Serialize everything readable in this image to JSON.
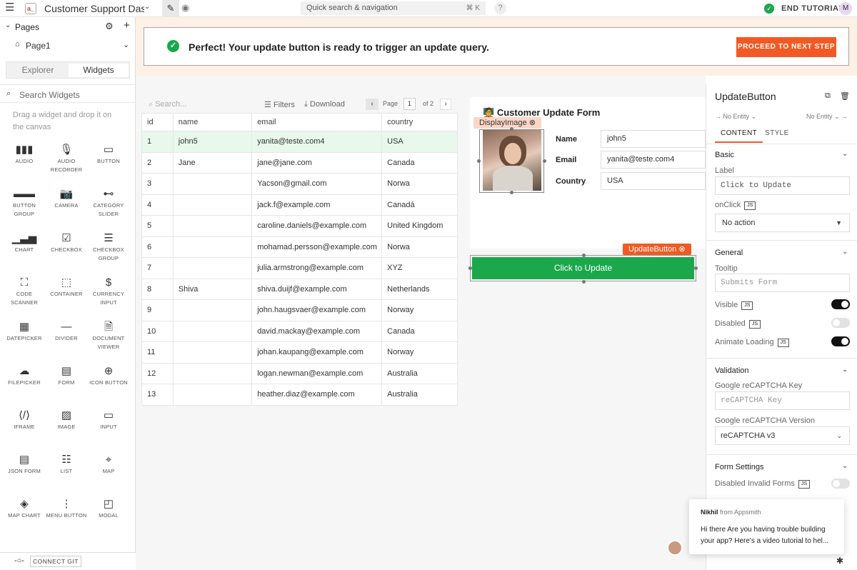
{
  "topbar": {
    "app_title": "Customer Support Das...",
    "search_placeholder": "Quick search & navigation",
    "search_shortcut": "⌘ K",
    "help": "?",
    "end_tutorial": "END TUTORIAL",
    "avatar_initial": "M"
  },
  "sidebar": {
    "pages_title": "Pages",
    "page1": "Page1",
    "tab_explorer": "Explorer",
    "tab_widgets": "Widgets",
    "search_widgets": "Search Widgets",
    "hint": "Drag a widget and drop it on the canvas",
    "widgets": [
      {
        "icon": "audio-icon",
        "glyph": "▮▮▮",
        "name": "AUDIO"
      },
      {
        "icon": "microphone-icon",
        "glyph": "🎙",
        "name": "AUDIO RECORDER"
      },
      {
        "icon": "button-icon",
        "glyph": "▭",
        "name": "BUTTON"
      },
      {
        "icon": "button-group-icon",
        "glyph": "▬▬",
        "name": "BUTTON GROUP"
      },
      {
        "icon": "camera-icon",
        "glyph": "📷",
        "name": "CAMERA"
      },
      {
        "icon": "slider-icon",
        "glyph": "⊷",
        "name": "CATEGORY SLIDER"
      },
      {
        "icon": "chart-icon",
        "glyph": "▁▃▅",
        "name": "CHART"
      },
      {
        "icon": "checkbox-icon",
        "glyph": "☑",
        "name": "CHECKBOX"
      },
      {
        "icon": "checkbox-group-icon",
        "glyph": "☰",
        "name": "CHECKBOX GROUP"
      },
      {
        "icon": "code-scanner-icon",
        "glyph": "⛶",
        "name": "CODE SCANNER"
      },
      {
        "icon": "container-icon",
        "glyph": "⬚",
        "name": "CONTAINER"
      },
      {
        "icon": "currency-input-icon",
        "glyph": "$",
        "name": "CURRENCY INPUT"
      },
      {
        "icon": "datepicker-icon",
        "glyph": "▦",
        "name": "DATEPICKER"
      },
      {
        "icon": "divider-icon",
        "glyph": "—",
        "name": "DIVIDER"
      },
      {
        "icon": "document-viewer-icon",
        "glyph": "🗎",
        "name": "DOCUMENT VIEWER"
      },
      {
        "icon": "filepicker-icon",
        "glyph": "☁",
        "name": "FILEPICKER"
      },
      {
        "icon": "form-icon",
        "glyph": "▤",
        "name": "FORM"
      },
      {
        "icon": "icon-button-icon",
        "glyph": "⊕",
        "name": "ICON BUTTON"
      },
      {
        "icon": "iframe-icon",
        "glyph": "⟨/⟩",
        "name": "IFRAME"
      },
      {
        "icon": "image-icon",
        "glyph": "▨",
        "name": "IMAGE"
      },
      {
        "icon": "input-icon",
        "glyph": "▭",
        "name": "INPUT"
      },
      {
        "icon": "json-form-icon",
        "glyph": "▤",
        "name": "JSON FORM"
      },
      {
        "icon": "list-icon",
        "glyph": "☷",
        "name": "LIST"
      },
      {
        "icon": "map-icon",
        "glyph": "⌖",
        "name": "MAP"
      },
      {
        "icon": "map-chart-icon",
        "glyph": "◈",
        "name": "MAP CHART"
      },
      {
        "icon": "menu-button-icon",
        "glyph": "⋮",
        "name": "MENU BUTTON"
      },
      {
        "icon": "modal-icon",
        "glyph": "◰",
        "name": "MODAL"
      }
    ],
    "connect_git": "CONNECT GIT"
  },
  "banner": {
    "message": "Perfect! Your update button is ready to trigger an update query.",
    "next_button": "PROCEED TO NEXT STEP"
  },
  "table": {
    "search_placeholder": "Search...",
    "filters": "Filters",
    "download": "Download",
    "page_label": "Page",
    "page_number": "1",
    "page_of": "of 2",
    "columns": [
      "id",
      "name",
      "email",
      "country"
    ],
    "rows": [
      [
        "1",
        "john5",
        "yanita@teste.com4",
        "USA"
      ],
      [
        "2",
        "Jane",
        "jane@jane.com",
        "Canada"
      ],
      [
        "3",
        "",
        "Yacson@gmail.com",
        "Norwa"
      ],
      [
        "4",
        "",
        "jack.f@example.com",
        "Canadá"
      ],
      [
        "5",
        "",
        "caroline.daniels@example.com",
        "United Kingdom"
      ],
      [
        "6",
        "",
        "mohamad.persson@example.com",
        "Norwa"
      ],
      [
        "7",
        "",
        "julia.armstrong@example.com",
        "XYZ"
      ],
      [
        "8",
        "Shiva",
        "shiva.duijf@example.com",
        "Netherlands"
      ],
      [
        "9",
        "",
        "john.haugsvaer@example.com",
        "Norway"
      ],
      [
        "10",
        "",
        "david.mackay@example.com",
        "Canada"
      ],
      [
        "11",
        "",
        "johan.kaupang@example.com",
        "Norway"
      ],
      [
        "12",
        "",
        "logan.newman@example.com",
        "Australia"
      ],
      [
        "13",
        "",
        "heather.diaz@example.com",
        "Australia"
      ]
    ]
  },
  "form": {
    "title": "Customer Update Form",
    "image_tag": "DisplayImage ⊗",
    "name_label": "Name",
    "name_value": "john5",
    "email_label": "Email",
    "email_value": "yanita@teste.com4",
    "country_label": "Country",
    "country_value": "USA",
    "button_tag": "UpdateButton ⊗",
    "update_button": "Click to Update"
  },
  "panel": {
    "widget_name": "UpdateButton",
    "no_entity_left": "→ No Entity ⌄",
    "no_entity_right": "No Entity ⌄ →",
    "tab_content": "CONTENT",
    "tab_style": "STYLE",
    "basic": "Basic",
    "label_label": "Label",
    "label_value": "Click to Update",
    "onclick_label": "onClick",
    "onclick_value": "No action",
    "general": "General",
    "tooltip_label": "Tooltip",
    "tooltip_placeholder": "Submits Form",
    "visible_label": "Visible",
    "disabled_label": "Disabled",
    "animate_label": "Animate Loading",
    "validation": "Validation",
    "recaptcha_key_label": "Google reCAPTCHA Key",
    "recaptcha_key_placeholder": "reCAPTCHA Key",
    "recaptcha_version_label": "Google reCAPTCHA Version",
    "recaptcha_version_value": "reCAPTCHA v3",
    "form_settings": "Form Settings",
    "disabled_invalid_label": "Disabled Invalid Forms",
    "js": "JS",
    "toggles": {
      "visible": true,
      "disabled": false,
      "animate_loading": true,
      "disabled_invalid_forms": false
    }
  },
  "chat": {
    "sender": "Nikhil",
    "sender_suffix": "from Appsmith",
    "message": "Hi there Are you having trouble building your app? Here's a video tutorial to hel..."
  }
}
